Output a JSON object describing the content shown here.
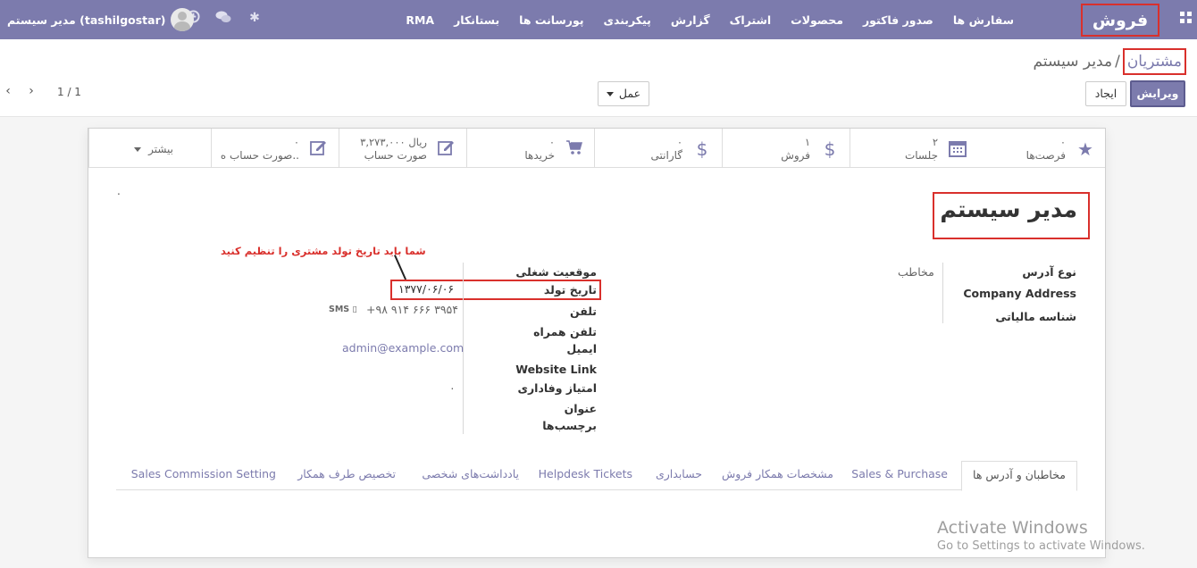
{
  "nav": {
    "brand": "فروش",
    "menu": [
      "سفارش ها",
      "صدور فاکتور",
      "محصولات",
      "اشتراک",
      "گزارش",
      "پیکربندی",
      "پورسانت ها",
      "بستانکار",
      "RMA"
    ],
    "user": "مدیر سیستم (tashilgostar)"
  },
  "breadcrumb": {
    "parent": "مشتریان",
    "separator": "/",
    "current": "مدیر سیستم"
  },
  "buttons": {
    "edit": "ویرایش",
    "create": "ایجاد",
    "action": "عمل"
  },
  "pager": {
    "value": "1 / 1"
  },
  "stats": [
    {
      "icon": "star-icon",
      "value": "۰",
      "label": "فرصت‌ها"
    },
    {
      "icon": "calendar-icon",
      "value": "۲",
      "label": "جلسات"
    },
    {
      "icon": "dollar-icon",
      "value": "۱",
      "label": "فروش"
    },
    {
      "icon": "dollar-icon",
      "value": "۰",
      "label": "گارانتی"
    },
    {
      "icon": "cart-icon",
      "value": "۰",
      "label": "خریدها"
    },
    {
      "icon": "pencil-icon",
      "value": "۳,۲۷۳,۰۰۰ ریال",
      "label": "صورت حساب"
    },
    {
      "icon": "pencil-icon",
      "value": "۰",
      "label": "صورت حساب ه.."
    },
    {
      "icon": "",
      "value": "",
      "label": "بیشتر"
    }
  ],
  "partner": {
    "name": "مدیر سیستم",
    "dot": ".",
    "hint": "شما باید تاریخ تولد مشتری را تنظیم کنید"
  },
  "right_fields": [
    {
      "label": "نوع آدرس",
      "value": "مخاطب"
    },
    {
      "label": "Company Address",
      "value": ""
    },
    {
      "label": "شناسه مالیاتی",
      "value": ""
    }
  ],
  "left_fields": [
    {
      "label": "موقعیت شغلی",
      "value": ""
    },
    {
      "label": "تاریخ تولد",
      "value": "۱۳۷۷/۰۶/۰۶"
    },
    {
      "label": "تلفن",
      "value": "+۹۸ ۹۱۴ ۶۶۶ ۳۹۵۴"
    },
    {
      "label": "تلفن همراه",
      "value": ""
    },
    {
      "label": "ایمیل",
      "value": "admin@example.com"
    },
    {
      "label": "Website Link",
      "value": ""
    },
    {
      "label": "امتیاز وفاداری",
      "value": "۰"
    },
    {
      "label": "عنوان",
      "value": ""
    },
    {
      "label": "برچسب‌ها",
      "value": ""
    }
  ],
  "sms_label": "SMS",
  "tabs": [
    "مخاطبان و آدرس ها",
    "Sales & Purchase",
    "مشخصات همکار فروش",
    "حسابداری",
    "Helpdesk Tickets",
    "یادداشت‌های شخصی",
    "تخصیص طرف همکار",
    "Sales Commission Setting"
  ],
  "watermark": {
    "line1": "Activate Windows",
    "line2": "Go to Settings to activate Windows."
  }
}
